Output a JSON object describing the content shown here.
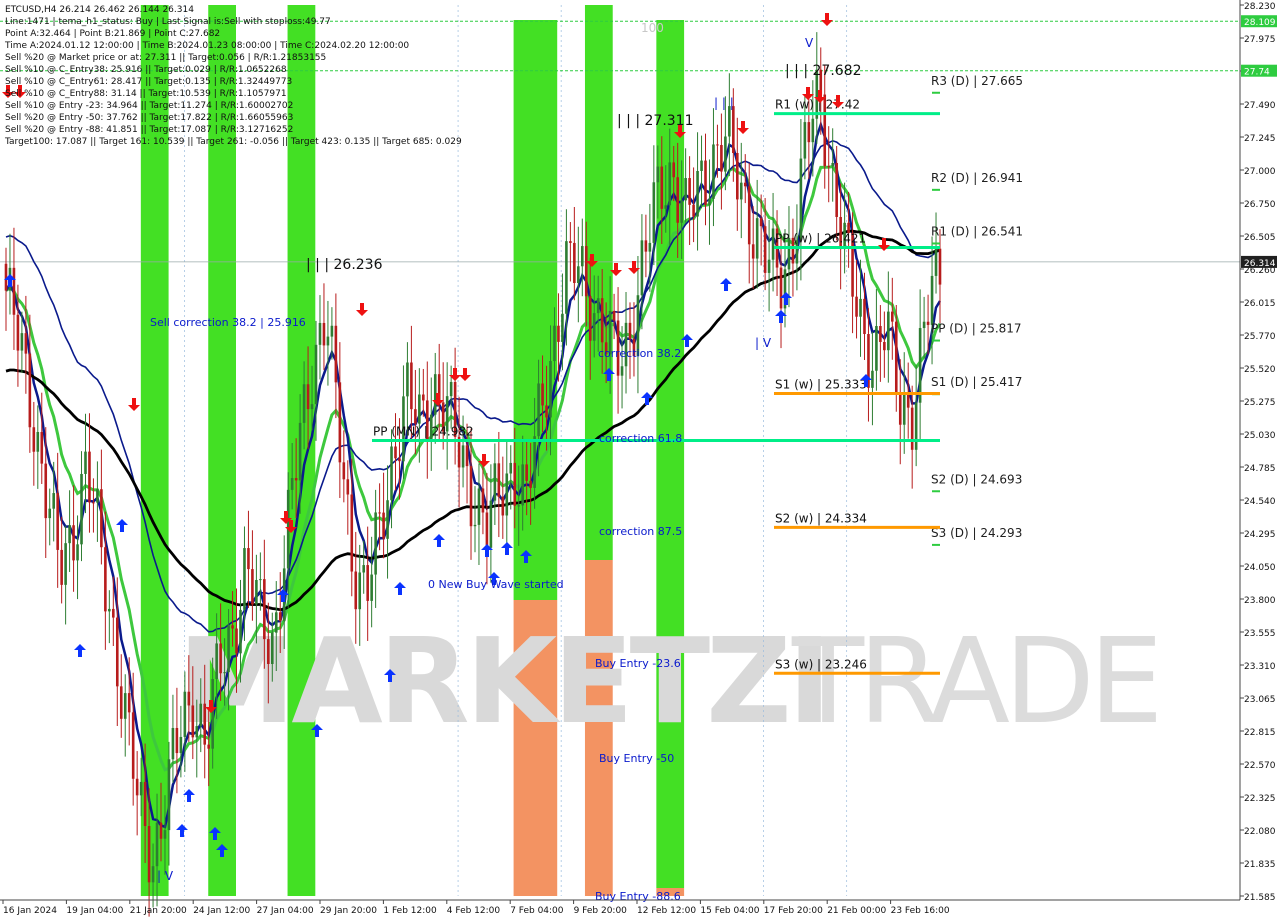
{
  "info": {
    "lines": [
      "ETCUSD,H4  26.214 26.462 26.144 26.314",
      "Line:1471 | tema_h1_status: Buy | Last Signal is:Sell with stoploss:49.77",
      "Point A:32.464 | Point B:21.869 | Point C:27.682",
      "Time A:2024.01.12 12:00:00 | Time B:2024.01.23 08:00:00 | Time C:2024.02.20 12:00:00",
      "Sell %20 @ Market price or at: 27.311 || Target:0.056 | R/R:1.21853155",
      "Sell %10 @ C_Entry38: 25.916 || Target:0.029 | R/R:1.0652268",
      "Sell %10 @ C_Entry61: 28.417 || Target:0.135 | R/R:1.32449773",
      "Sell %10 @ C_Entry88: 31.14 || Target:10.539 | R/R:1.1057971",
      "Sell %10 @ Entry -23: 34.964 || Target:11.274 | R/R:1.60002702",
      "Sell %20 @ Entry -50: 37.762 || Target:17.822 | R/R:1.66055963",
      "Sell %20 @ Entry -88: 41.851 || Target:17.087 | R/R:3.12716252",
      "Target100: 17.087 || Target 161: 10.539 || Target 261: -0.056 || Target 423: 0.135 || Target 685: 0.029"
    ]
  },
  "watermark": {
    "left": "MARKETZI",
    "right": "TRADE"
  },
  "annotations": {
    "fib_100": "100",
    "point_a": "| | | 26.236",
    "point_b": "| | | 27.311",
    "point_c": "| | | 27.682",
    "sell_correction": "Sell correction 38.2 | 25.916",
    "correction_38": "correction 38.2",
    "correction_61": "correction 61.8",
    "correction_87": "correction 87.5",
    "new_buy_wave": "0 New Buy Wave started",
    "buy_entry_23": "Buy Entry -23.6",
    "buy_entry_50": "Buy Entry -50",
    "buy_entry_88": "Buy Entry -88.6",
    "wave_mark_v1": "V",
    "wave_mark_v2": "| V",
    "wave_mark_v3": "| V",
    "wave_mark_v4": "| | |"
  },
  "levels": [
    {
      "label": "R3 (D) | 27.665",
      "value": 27.665,
      "kind": "daily"
    },
    {
      "label": "R2 (D) | 26.941",
      "value": 26.941,
      "kind": "daily"
    },
    {
      "label": "R1 (D) | 26.541",
      "value": 26.541,
      "kind": "daily"
    },
    {
      "label": "PP (D) | 25.817",
      "value": 25.817,
      "kind": "daily"
    },
    {
      "label": "S1 (D) | 25.417",
      "value": 25.417,
      "kind": "daily"
    },
    {
      "label": "S2 (D) | 24.693",
      "value": 24.693,
      "kind": "daily"
    },
    {
      "label": "S3 (D) | 24.293",
      "value": 24.293,
      "kind": "daily"
    },
    {
      "label": "R1 (w) | 27.42",
      "value": 27.42,
      "kind": "weekly-res"
    },
    {
      "label": "PP (w) | 26.421",
      "value": 26.421,
      "kind": "weekly-res"
    },
    {
      "label": "S1 (w) | 25.333",
      "value": 25.333,
      "kind": "weekly-sup"
    },
    {
      "label": "S2 (w) | 24.334",
      "value": 24.334,
      "kind": "weekly-sup"
    },
    {
      "label": "S3 (w) | 23.246",
      "value": 23.246,
      "kind": "weekly-sup"
    },
    {
      "label": "PP (MN) | 24.982",
      "value": 24.982,
      "kind": "monthly"
    }
  ],
  "chart_data": {
    "type": "candlestick",
    "symbol": "ETCUSD,H4",
    "ohlc_last": {
      "open": 26.214,
      "high": 26.462,
      "low": 26.144,
      "close": 26.314
    },
    "current_price": 26.314,
    "ylim": [
      21.585,
      28.23
    ],
    "y_ticks": [
      "28.230",
      "27.975",
      "27.735",
      "27.490",
      "27.245",
      "27.000",
      "26.750",
      "26.505",
      "26.260",
      "26.015",
      "25.770",
      "25.520",
      "25.275",
      "25.030",
      "24.785",
      "24.540",
      "24.295",
      "24.050",
      "23.800",
      "23.555",
      "23.310",
      "23.065",
      "22.815",
      "22.570",
      "22.325",
      "22.080",
      "21.835",
      "21.585"
    ],
    "price_tags": [
      {
        "text": "26.314",
        "value": 26.314,
        "color": "#202020"
      },
      {
        "text": "28.109",
        "value": 28.109,
        "color": "#2ecc40"
      },
      {
        "text": "27.74",
        "value": 27.74,
        "color": "#2ecc40"
      }
    ],
    "x_ticks": [
      "16 Jan 2024",
      "19 Jan 04:00",
      "21 Jan 20:00",
      "24 Jan 12:00",
      "27 Jan 04:00",
      "29 Jan 20:00",
      "1 Feb 12:00",
      "4 Feb 12:00",
      "7 Feb 04:00",
      "9 Feb 20:00",
      "12 Feb 12:00",
      "15 Feb 04:00",
      "17 Feb 20:00",
      "21 Feb 00:00",
      "23 Feb 16:00"
    ],
    "close_path": [
      26.1,
      25.7,
      25.2,
      24.6,
      24.0,
      24.3,
      24.8,
      24.2,
      23.6,
      22.9,
      22.2,
      21.9,
      22.3,
      22.8,
      23.1,
      22.7,
      23.3,
      23.6,
      24.0,
      23.7,
      23.5,
      24.2,
      25.0,
      25.6,
      25.9,
      25.0,
      24.1,
      23.8,
      24.3,
      24.9,
      25.3,
      25.1,
      25.4,
      25.2,
      24.9,
      24.6,
      24.3,
      24.6,
      24.8,
      24.5,
      25.2,
      25.7,
      26.2,
      26.3,
      26.0,
      25.7,
      25.6,
      25.9,
      26.4,
      26.9,
      27.0,
      26.6,
      26.9,
      27.1,
      27.2,
      26.9,
      26.6,
      26.3,
      26.2,
      26.5,
      27.2,
      27.6,
      26.9,
      26.3,
      25.9,
      25.6,
      25.8,
      25.3,
      25.2,
      25.9,
      26.3
    ],
    "close_path_start": "16 Jan 2024 00:00",
    "close_path_end": "24 Feb 00:00",
    "series": [
      {
        "name": "tema_fast",
        "color": "#0a1a8c"
      },
      {
        "name": "tema_mid",
        "color": "#3ec83e"
      },
      {
        "name": "tema_slow",
        "color": "#0a1a8c"
      },
      {
        "name": "ma_long",
        "color": "#000000"
      }
    ]
  },
  "colors": {
    "up_candle": "#2e7d32",
    "down_candle": "#b71c1c",
    "green_band": "#33dd11",
    "orange_band": "#f28a55",
    "level_green": "#00ee88",
    "level_orange": "#ff9900",
    "daily_level": "#202020",
    "annotation_blue": "#0a1acc",
    "arrow_up": "#0a33ff",
    "arrow_down": "#ee1111"
  }
}
